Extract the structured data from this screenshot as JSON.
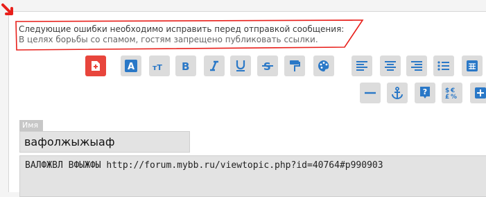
{
  "errors": {
    "heading": "Следующие ошибки необходимо исправить перед отправкой сообщения:",
    "message": "В целях борьбы со спамом, гостям запрещено публиковать ссылки."
  },
  "toolbar": {
    "accent": "#2a78c7",
    "danger": "#e8453c",
    "row1": [
      "new-document",
      "text-color",
      "text-size",
      "bold",
      "italic",
      "underline",
      "strikethrough",
      "paint",
      "palette",
      "align-left",
      "align-center",
      "align-right",
      "list",
      "table"
    ],
    "row2": [
      "horizontal-rule",
      "anchor",
      "spoiler-help",
      "symbols",
      "add-more"
    ]
  },
  "form": {
    "name_label": "Имя",
    "name_value": "вафолжыжыаф",
    "message_value": "ВАЛФЖВЛ ВФЫЖФЫ http://forum.mybb.ru/viewtopic.php?id=40764#p990903"
  }
}
